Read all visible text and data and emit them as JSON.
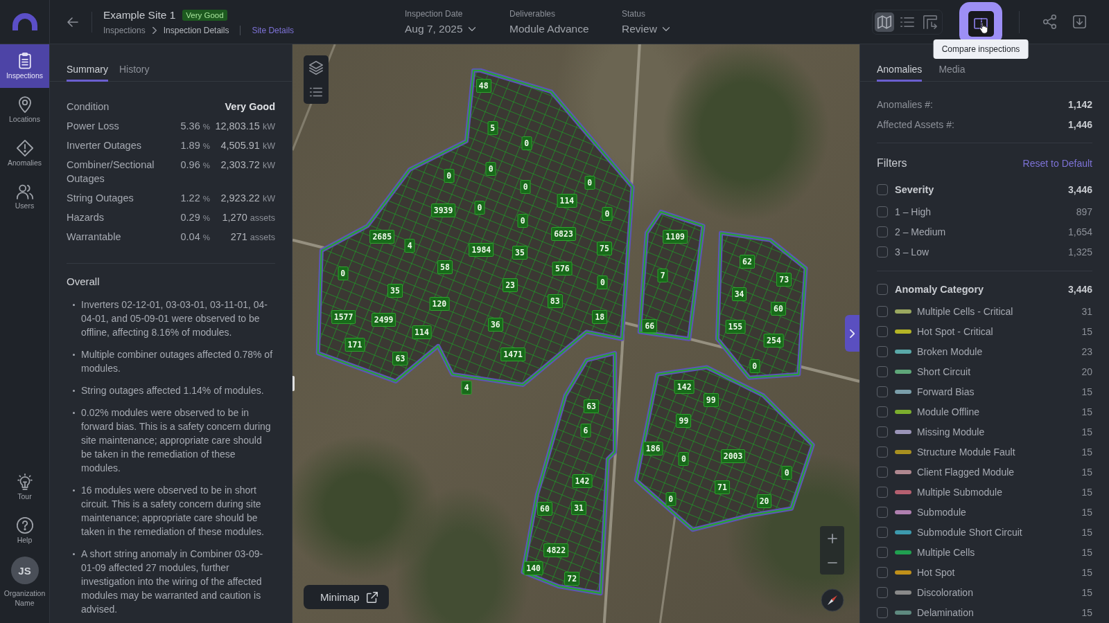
{
  "topbar": {
    "title": "Example Site 1",
    "condition_badge": "Very Good",
    "breadcrumb": [
      {
        "label": "Inspections",
        "current": false
      },
      {
        "label": "Inspection Details",
        "current": true
      }
    ],
    "site_link": "Site Details",
    "fields": [
      {
        "label": "Inspection Date",
        "value": "Aug 7, 2025",
        "dropdown": true
      },
      {
        "label": "Deliverables",
        "value": "Module Advance",
        "dropdown": false
      },
      {
        "label": "Status",
        "value": "Review",
        "dropdown": true
      }
    ],
    "view_modes": [
      {
        "selected": true
      },
      {
        "selected": false
      },
      {
        "selected": false
      }
    ],
    "compare_button": {
      "focused": true,
      "tooltip": "Compare inspections"
    }
  },
  "nav": {
    "items": [
      {
        "label": "Inspections",
        "selected": true
      },
      {
        "label": "Locations",
        "selected": false
      },
      {
        "label": "Anomalies",
        "selected": false
      },
      {
        "label": "Users",
        "selected": false
      }
    ],
    "bottom": [
      {
        "label": "Tour"
      },
      {
        "label": "Help"
      }
    ],
    "user": {
      "initials": "JS",
      "name": "Organization Name"
    }
  },
  "summary": {
    "tabs": [
      {
        "label": "Summary",
        "selected": true
      },
      {
        "label": "History",
        "selected": false
      }
    ],
    "stats": [
      {
        "kind": "condition",
        "label": "Condition",
        "value": "Very Good"
      },
      {
        "kind": "metric",
        "label": "Power Loss",
        "percent": "5.36",
        "percent_unit": "%",
        "amount": "12,803.15",
        "unit": "kW"
      },
      {
        "kind": "metric",
        "label": "Inverter Outages",
        "percent": "1.89",
        "percent_unit": "%",
        "amount": "4,505.91",
        "unit": "kW"
      },
      {
        "kind": "metric",
        "label": "Combiner/Sectional Outages",
        "percent": "0.96",
        "percent_unit": "%",
        "amount": "2,303.72",
        "unit": "kW"
      },
      {
        "kind": "metric",
        "label": "String Outages",
        "percent": "1.22",
        "percent_unit": "%",
        "amount": "2,923.22",
        "unit": "kW"
      },
      {
        "kind": "metric",
        "label": "Hazards",
        "percent": "0.29",
        "percent_unit": "%",
        "amount": "1,270",
        "unit": "assets"
      },
      {
        "kind": "metric",
        "label": "Warrantable",
        "percent": "0.04",
        "percent_unit": "%",
        "amount": "271",
        "unit": "assets"
      }
    ],
    "overall": {
      "title": "Overall",
      "bullets": [
        "Inverters 02-12-01, 03-03-01, 03-11-01, 04-04-01, and 05-09-01 were observed to be offline, affecting 8.16% of modules.",
        "Multiple combiner outages affected 0.78% of modules.",
        "String outages affected 1.14% of modules.",
        "0.02% modules were observed to be in forward bias. This is a safety concern during site maintenance; appropriate care should be taken in the remediation of these modules.",
        "16 modules were observed to be in short circuit. This is a safety concern during site maintenance; appropriate care should be taken in the remediation of these modules.",
        "A short string anomaly in Combiner 03-09-01-09 affected 27 modules, further investigation into the wiring of the affected modules may be warranted and caution is advised."
      ]
    }
  },
  "map": {
    "markers": [
      "48",
      "5",
      "0",
      "0",
      "0",
      "0",
      "0",
      "114",
      "3939",
      "0",
      "0",
      "0",
      "6823",
      "2685",
      "4",
      "1984",
      "35",
      "75",
      "1109",
      "58",
      "576",
      "0",
      "35",
      "120",
      "23",
      "0",
      "7",
      "62",
      "73",
      "34",
      "83",
      "18",
      "60",
      "1577",
      "2499",
      "114",
      "36",
      "66",
      "155",
      "254",
      "171",
      "63",
      "1471",
      "0",
      "4",
      "142",
      "99",
      "63",
      "6",
      "99",
      "186",
      "0",
      "2003",
      "0",
      "142",
      "71",
      "0",
      "20",
      "60",
      "31",
      "4822",
      "140",
      "72"
    ],
    "minimap_button": "Minimap"
  },
  "anomalies_panel": {
    "tabs": [
      {
        "label": "Anomalies",
        "selected": true
      },
      {
        "label": "Media",
        "selected": false
      }
    ],
    "totals": [
      {
        "label": "Anomalies #:",
        "value": "1,142"
      },
      {
        "label": "Affected Assets #:",
        "value": "1,446"
      }
    ],
    "filters": {
      "title": "Filters",
      "reset_link": "Reset to Default",
      "groups": [
        {
          "label": "Severity",
          "count": "3,446",
          "checked": false,
          "items": [
            {
              "label": "1 – High",
              "count": "897",
              "checked": false
            },
            {
              "label": "2 – Medium",
              "count": "1,654",
              "checked": false
            },
            {
              "label": "3 – Low",
              "count": "1,325",
              "checked": false
            }
          ]
        },
        {
          "label": "Anomaly Category",
          "count": "3,446",
          "checked": false,
          "items": [
            {
              "label": "Multiple Cells - Critical",
              "count": "31",
              "checked": false,
              "color": "#9aa860"
            },
            {
              "label": "Hot Spot - Critical",
              "count": "15",
              "checked": false,
              "color": "#b5b526"
            },
            {
              "label": "Broken Module",
              "count": "23",
              "checked": false,
              "color": "#5aa9a9"
            },
            {
              "label": "Short Circuit",
              "count": "20",
              "checked": false,
              "color": "#5fa77a"
            },
            {
              "label": "Forward Bias",
              "count": "15",
              "checked": false,
              "color": "#7b9fab"
            },
            {
              "label": "Module Offline",
              "count": "15",
              "checked": false,
              "color": "#7cae2e"
            },
            {
              "label": "Missing Module",
              "count": "15",
              "checked": false,
              "color": "#9a94b8"
            },
            {
              "label": "Structure Module Fault",
              "count": "15",
              "checked": false,
              "color": "#a99020"
            },
            {
              "label": "Client Flagged Module",
              "count": "15",
              "checked": false,
              "color": "#b08890"
            },
            {
              "label": "Multiple Submodule",
              "count": "15",
              "checked": false,
              "color": "#b56070"
            },
            {
              "label": "Submodule",
              "count": "15",
              "checked": false,
              "color": "#b080b0"
            },
            {
              "label": "Submodule Short Circuit",
              "count": "15",
              "checked": false,
              "color": "#3d9aae"
            },
            {
              "label": "Multiple Cells",
              "count": "15",
              "checked": false,
              "color": "#20a050"
            },
            {
              "label": "Hot Spot",
              "count": "15",
              "checked": false,
              "color": "#c0901a"
            },
            {
              "label": "Discoloration",
              "count": "15",
              "checked": false,
              "color": "#8a8a8a"
            },
            {
              "label": "Delamination",
              "count": "15",
              "checked": false,
              "color": "#5f8a80"
            }
          ]
        }
      ]
    }
  }
}
